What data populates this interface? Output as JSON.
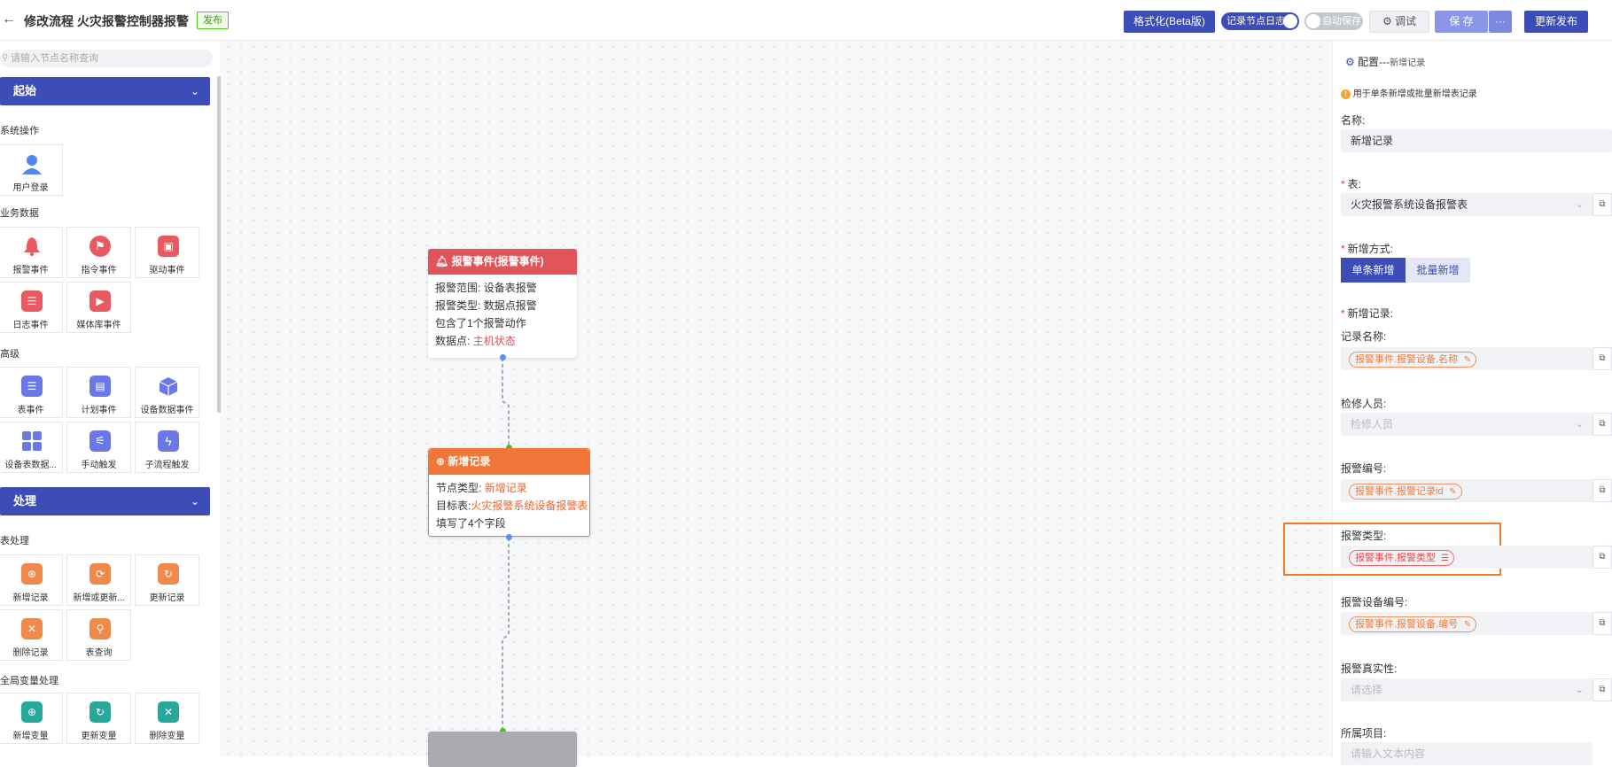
{
  "header": {
    "back_icon": "arrow-left-icon",
    "title": "修改流程 火灾报警控制器报警",
    "status_badge": "发布",
    "format_button": "格式化(Beta版)",
    "log_toggle_label": "记录节点日志",
    "autosave_toggle_label": "自动保存",
    "debug_button": "调试",
    "save_button": "保 存",
    "more_button": "···",
    "publish_button": "更新发布"
  },
  "sidebar": {
    "search_placeholder": "请输入节点名称查询",
    "section_start": "起始",
    "section_process": "处理",
    "groups": {
      "system": "系统操作",
      "business": "业务数据",
      "advanced": "高级",
      "table": "表处理",
      "global": "全局变量处理"
    },
    "tiles": {
      "user_login": "用户登录",
      "alarm_event": "报警事件",
      "command_event": "指令事件",
      "driver_event": "驱动事件",
      "log_event": "日志事件",
      "media_event": "媒体库事件",
      "table_event": "表事件",
      "plan_event": "计划事件",
      "device_data_event": "设备数据事件",
      "device_table_data": "设备表数据...",
      "manual_trigger": "手动触发",
      "subflow_trigger": "子流程触发",
      "add_record": "新增记录",
      "add_or_update": "新增或更新...",
      "update_record": "更新记录",
      "delete_record": "删除记录",
      "table_query": "表查询",
      "add_var": "新增变量",
      "update_var": "更新变量",
      "delete_var": "删除变量"
    }
  },
  "canvas": {
    "alarm_node": {
      "title": "报警事件(报警事件)",
      "line1_label": "报警范围:",
      "line1_value": "设备表报警",
      "line2_label": "报警类型:",
      "line2_value": "数据点报警",
      "line3": "包含了1个报警动作",
      "line4_label": "数据点:",
      "line4_value": "主机状态"
    },
    "add_node": {
      "title": "新增记录",
      "line1_label": "节点类型:",
      "line1_value": "新增记录",
      "line2_label": "目标表:",
      "line2_value": "火灾报警系统设备报警表",
      "line3": "填写了4个字段"
    }
  },
  "panel": {
    "header_title": "配置---",
    "header_sub": "新增记录",
    "tip": "用于单条新增或批量新增表记录",
    "name_label": "名称:",
    "name_value": "新增记录",
    "table_label": "表:",
    "table_value": "火灾报警系统设备报警表",
    "mode_label": "新增方式:",
    "mode_single": "单条新增",
    "mode_batch": "批量新增",
    "record_label": "新增记录:",
    "fields": [
      {
        "label": "记录名称:",
        "tag": "报警事件.报警设备.名称"
      },
      {
        "label": "检修人员:",
        "placeholder": "检修人员"
      },
      {
        "label": "报警编号:",
        "tag": "报警事件.报警记录id"
      },
      {
        "label": "报警类型:",
        "tag": "报警事件.报警类型"
      },
      {
        "label": "报警设备编号:",
        "tag": "报警事件.报警设备.编号"
      },
      {
        "label": "报警真实性:",
        "placeholder": "请选择"
      },
      {
        "label": "所属项目:",
        "placeholder": "请输入文本内容"
      }
    ]
  },
  "colors": {
    "primary": "#3d4db7",
    "alarm_header": "#e2545c",
    "record_header": "#f0763a",
    "highlight_box": "#f07a2a"
  }
}
